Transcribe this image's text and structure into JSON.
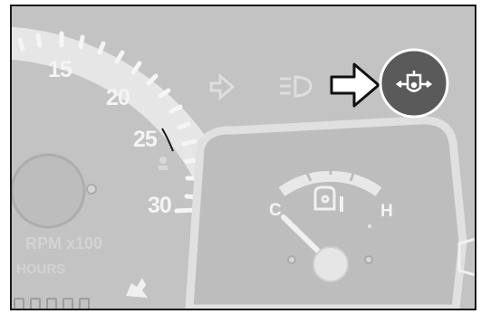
{
  "tachometer": {
    "tick_labels": [
      "15",
      "20",
      "25",
      "30"
    ],
    "scale_label": "RPM x100",
    "hours_label": "HOURS"
  },
  "fuel_gauge": {
    "empty_label": "C",
    "full_label": "H"
  },
  "indicators": [
    {
      "name": "turn-signal-icon",
      "state": "off"
    },
    {
      "name": "headlight-icon",
      "state": "off"
    },
    {
      "name": "oil-pressure-icon",
      "state": "highlighted"
    }
  ],
  "callout": {
    "icon": "right-arrow-icon"
  },
  "colors": {
    "panel": "#c3c3c3",
    "highlight_circle": "#5a5a5a",
    "arrow_fill": "#ffffff",
    "arrow_stroke": "#111111"
  }
}
